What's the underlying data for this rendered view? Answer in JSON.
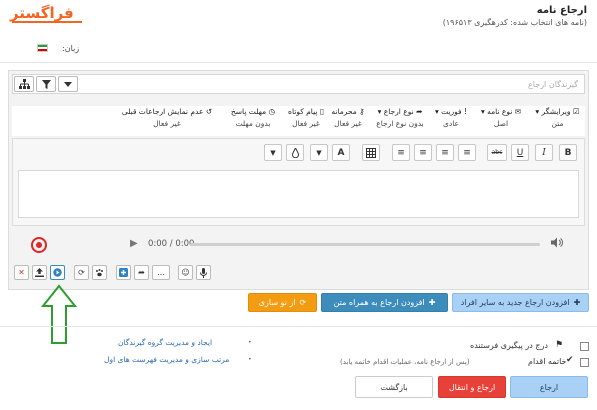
{
  "header": {
    "title": "ارجاع نامه",
    "subtitle": "(نامه های انتخاب شده: کدرهگیری ۱۹۶۵۱۳)",
    "brand": "فراگستر"
  },
  "language": {
    "label": "زبان:"
  },
  "recipients": {
    "placeholder": "گیرندگان ارجاع"
  },
  "options": [
    {
      "label": "ویرایشگر",
      "value": "متن"
    },
    {
      "label": "نوع نامه",
      "value": "اصل"
    },
    {
      "label": "فوریت",
      "value": "عادی"
    },
    {
      "label": "نوع ارجاع",
      "value": "بدون نوع ارجاع"
    },
    {
      "label": "محرمانه",
      "value": "غیر فعال"
    },
    {
      "label": "پیام کوتاه",
      "value": "غیر فعال"
    },
    {
      "label": "مهلت پاسخ",
      "value": "بدون مهلت"
    },
    {
      "label": "عدم نمایش ارجاعات قبلی",
      "value": "غیر فعال"
    }
  ],
  "audio": {
    "time": "0:00 / 0:00"
  },
  "actions": {
    "add_other": "افزودن ارجاع جدید به سایر افراد",
    "add_with_text": "افزودن ارجاع به همراه متن",
    "reset": "از نو سازی"
  },
  "links": {
    "manage_groups": "ایجاد و مدیریت گروه گیرندگان",
    "sort_lists": "مرتب سازی و مدیریت فهرست های اول"
  },
  "checks": {
    "track_sender": "درج در پیگیری فرستنده",
    "end_action": "خاتمه اقدام",
    "end_action_note": "(پس از ارجاع نامه، عملیات اقدام خاتمه یابد)"
  },
  "footer": {
    "refer": "ارجاع",
    "refer_transfer": "ارجاع و انتقال",
    "back": "بازگشت"
  },
  "colors": {
    "brand": "#f26522",
    "primary_blue": "#3c8dbc",
    "danger_red": "#e8413a",
    "warning_orange": "#f39c12",
    "light_blue": "#a9d0f5",
    "green_arrow": "#2e9e2e"
  }
}
